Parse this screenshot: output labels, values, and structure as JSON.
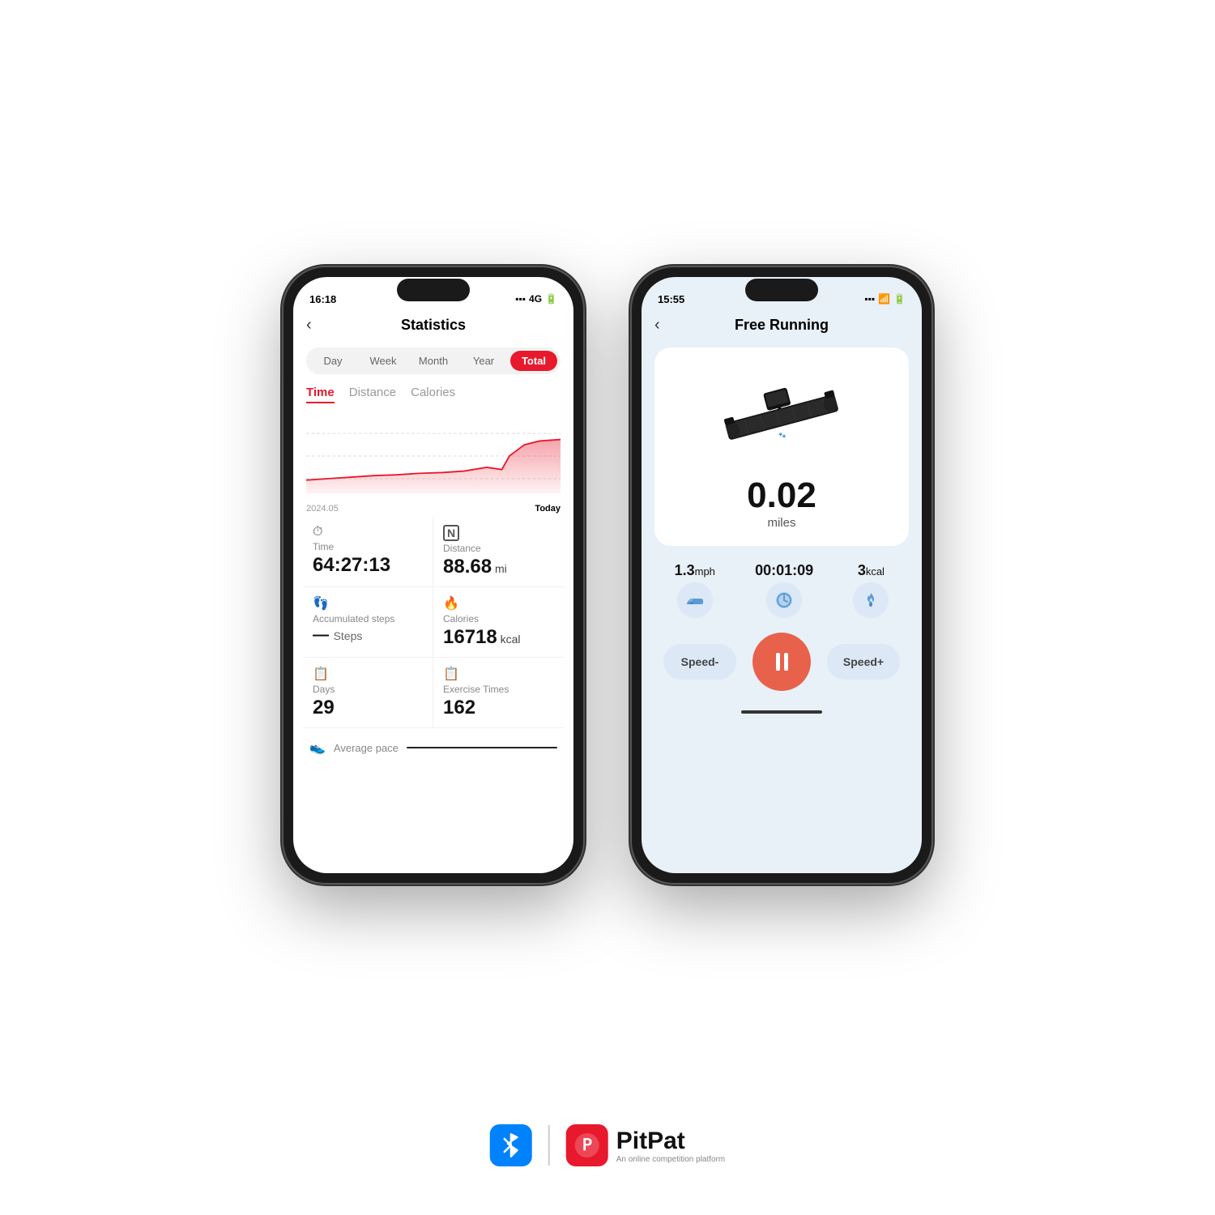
{
  "left_phone": {
    "status_time": "16:18",
    "status_signal": "4G",
    "title": "Statistics",
    "period_tabs": [
      "Day",
      "Week",
      "Month",
      "Year",
      "Total"
    ],
    "active_period": "Total",
    "metric_tabs": [
      "Time",
      "Distance",
      "Calories"
    ],
    "active_metric": "Time",
    "chart_start": "2024.05",
    "chart_end": "Today",
    "stats": [
      {
        "icon": "⏰",
        "label": "Time",
        "value": "64:27:13",
        "unit": ""
      },
      {
        "icon": "N",
        "label": "Distance",
        "value": "88.68",
        "unit": " mi"
      },
      {
        "icon": "👣",
        "label": "Accumulated steps",
        "value": "—",
        "unit": "Steps"
      },
      {
        "icon": "🔥",
        "label": "Calories",
        "value": "16718",
        "unit": " kcal"
      },
      {
        "icon": "📅",
        "label": "Days",
        "value": "29",
        "unit": ""
      },
      {
        "icon": "📅",
        "label": "Exercise Times",
        "value": "162",
        "unit": ""
      }
    ],
    "avg_pace_label": "Average pace"
  },
  "right_phone": {
    "status_time": "15:55",
    "title": "Free Running",
    "distance_value": "0.02",
    "distance_unit": "miles",
    "speed": "1.3",
    "speed_unit": "mph",
    "time_elapsed": "00:01:09",
    "calories": "3",
    "calories_unit": "kcal",
    "speed_minus": "Speed-",
    "speed_plus": "Speed+"
  },
  "branding": {
    "pitpat_name": "PitPat",
    "pitpat_sub": "An online competition platform"
  }
}
